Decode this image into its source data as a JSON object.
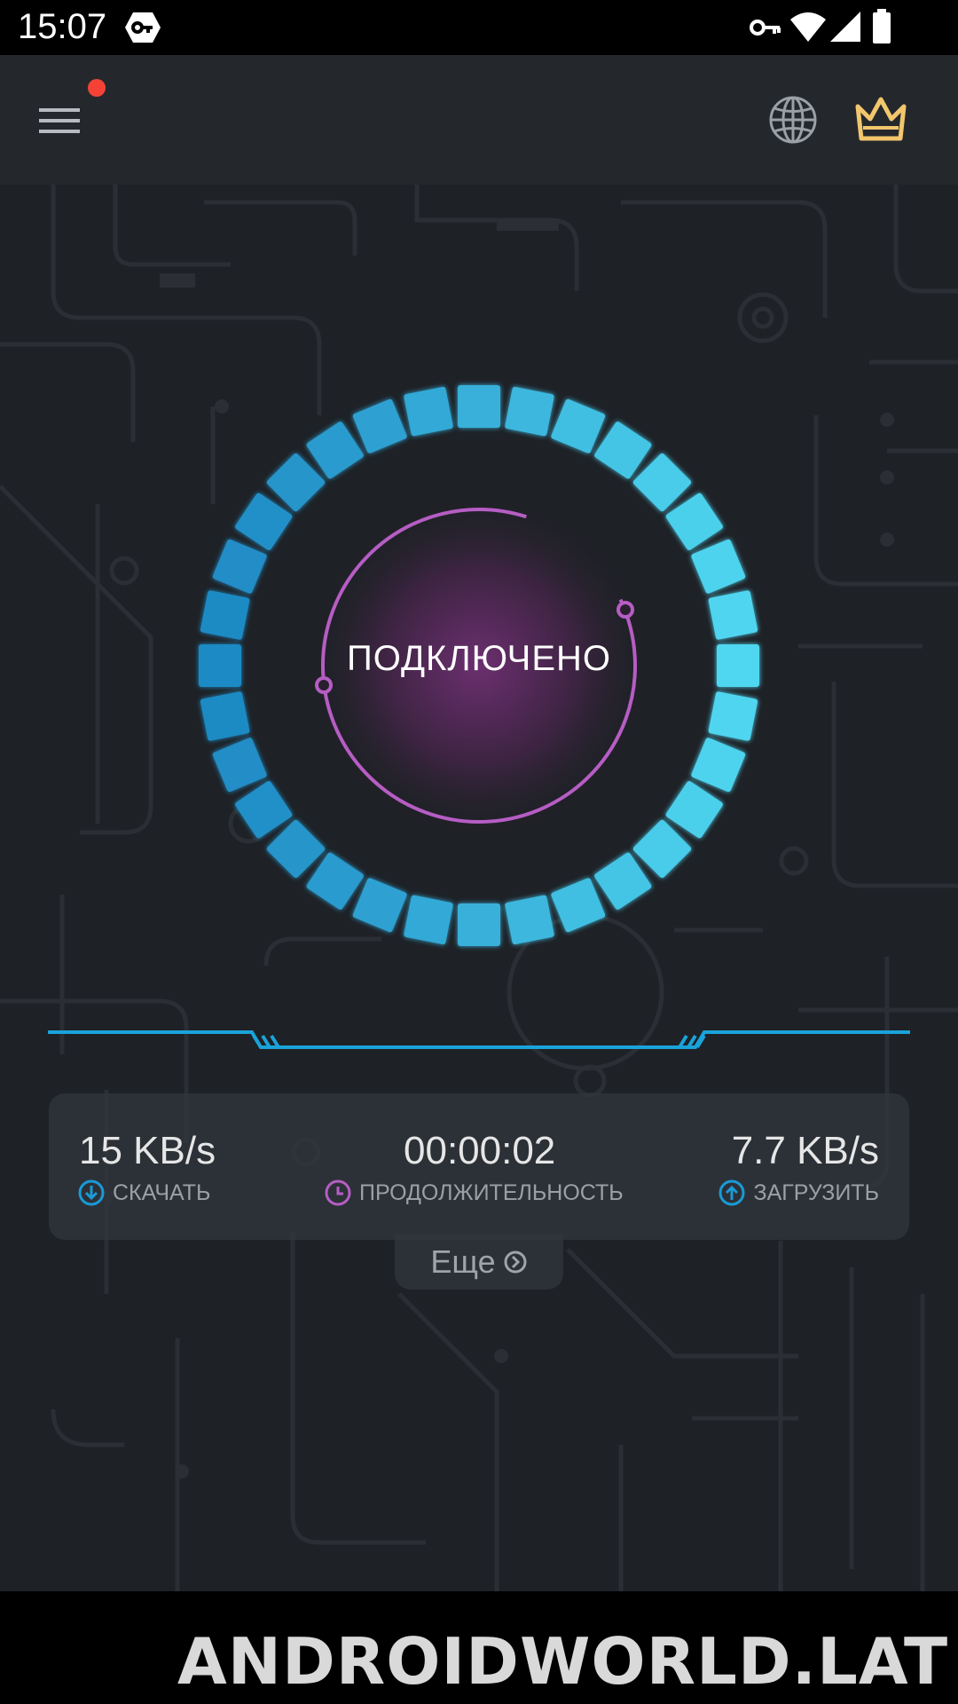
{
  "status_bar": {
    "time": "15:07",
    "icons": [
      "vpn-app-icon",
      "key-icon",
      "wifi-icon",
      "cell-signal-icon",
      "battery-icon"
    ]
  },
  "app_bar": {
    "icons": [
      "menu-icon",
      "globe-icon",
      "crown-icon"
    ],
    "notification_dot_color": "#f44336",
    "crown_color": "#f2c66d"
  },
  "connection": {
    "status": "ПОДКЛЮЧЕНО",
    "ring_color": "#3fc7ec",
    "inner_circle_color": "#b65dc4"
  },
  "stats": {
    "download": {
      "value": "15 KB/s",
      "label": "СКАЧАТЬ",
      "icon": "download-arrow-icon"
    },
    "duration": {
      "value": "00:00:02",
      "label": "ПРОДОЛЖИТЕЛЬНОСТЬ",
      "icon": "clock-icon"
    },
    "upload": {
      "value": "7.7 KB/s",
      "label": "ЗАГРУЗИТЬ",
      "icon": "upload-arrow-icon"
    }
  },
  "more": {
    "label": "Еще",
    "icon": "chevron-circle-right-icon"
  },
  "watermark": "ANDROIDWORLD.LAT"
}
